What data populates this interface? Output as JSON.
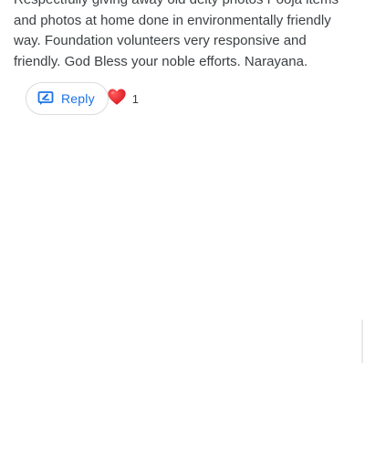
{
  "review": {
    "text": "Respectfully giving away old deity photos Pooja items and photos at home done in environmentally friendly way. Foundation volunteers very responsive and friendly. God Bless your noble efforts. Narayana."
  },
  "actions": {
    "reply_label": "Reply",
    "reply_icon": "reply-icon",
    "reaction_icon": "heart-icon",
    "reaction_count": "1"
  },
  "colors": {
    "accent": "#1a73e8",
    "heart": "#e8171b",
    "text": "#3c4043"
  }
}
